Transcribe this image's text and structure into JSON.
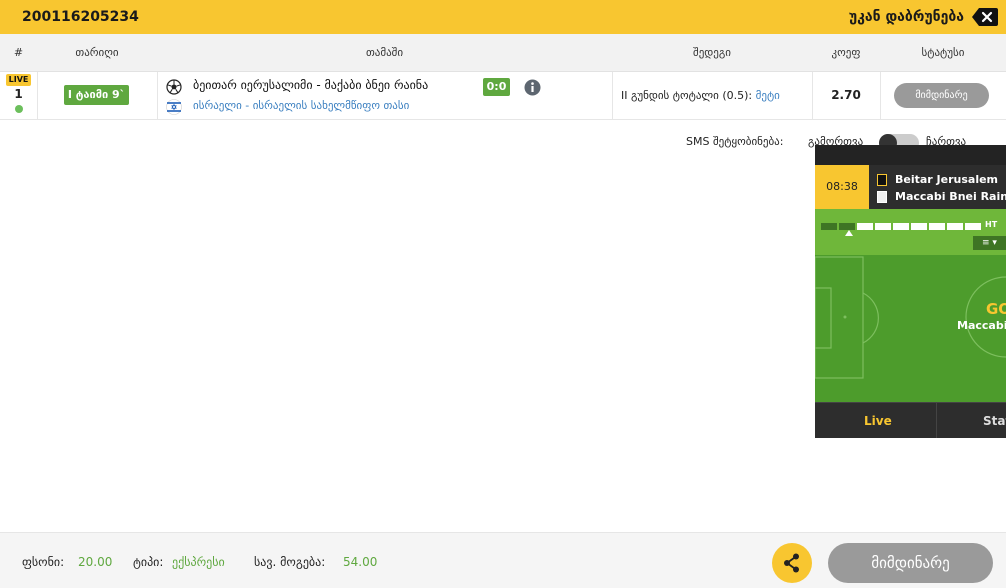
{
  "ticket": {
    "id": "200116205234",
    "back_label": "უკან დაბრუნება"
  },
  "table": {
    "headers": [
      "#",
      "თარიღი",
      "თამაში",
      "შედეგი",
      "კოეფ",
      "სტატუსი"
    ],
    "row": {
      "live_badge": "LIVE",
      "number": "1",
      "time": "I ტაიმი 9`",
      "match": "ბეითარ იერუსალიმი - მაქაბი ბნეი რაინა",
      "score": "0:0",
      "league": "ისრაელი - ისრაელის სახელმწიფო თასი",
      "market": "II გუნდის ტოტალი (0.5):",
      "outcome": "მეტი",
      "odds": "2.70",
      "status": "მიმდინარე"
    }
  },
  "sms": {
    "label": "SMS შეტყობინება:",
    "on_label": "გამორთვა",
    "off_label": "ჩართვა"
  },
  "widget": {
    "clock": "08:38",
    "home_team": "Beitar Jerusalem",
    "away_team": "Maccabi Bnei Raina",
    "ht_label": "HT",
    "menu_icon": "≡ ▾",
    "goal_text": "GOAL",
    "goal_team": "Maccabi Bnei Raina",
    "tabs": [
      "Live",
      "Stats"
    ],
    "colors": {
      "active_tab": "#f8c630",
      "pitch": "#4d9c2c",
      "timeline": "#6fb73a"
    }
  },
  "footer": {
    "stake_label": "ფსონი:",
    "stake_value": "20.00",
    "type_label": "ტიპი:",
    "type_value": "ექსპრესი",
    "win_label": "სავ. მოგება:",
    "win_value": "54.00",
    "status_button": "მიმდინარე"
  },
  "colors": {
    "accent": "#f8c630",
    "green": "#5fa83f",
    "link": "#3a7fc0",
    "status_grey": "#9a9a9a"
  },
  "icons": {
    "back": "backspace-icon",
    "ball": "soccer-ball-icon",
    "flag": "israel-flag-icon",
    "info": "info-icon",
    "share": "share-icon"
  }
}
